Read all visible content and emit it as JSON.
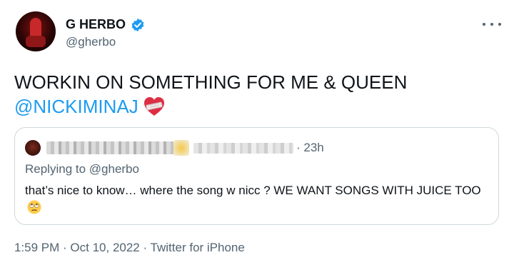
{
  "author": {
    "display_name": "G HERBO",
    "handle": "@gherbo",
    "verified_icon": "verified-badge-icon",
    "avatar_icon": "avatar"
  },
  "tweet": {
    "text": "WORKIN ON SOMETHING FOR ME & QUEEN",
    "mention": "@NICKIMINAJ",
    "emoji": "mending-heart-icon"
  },
  "quoted_tweet": {
    "time": "· 23h",
    "replying_to": "Replying to @gherbo",
    "text": "that’s nice to know… where the song w nicc ? WE WANT SONGS WITH JUICE TOO",
    "emoji": "face-with-rolling-eyes-icon"
  },
  "footer": {
    "meta": "1:59 PM · Oct 10, 2022 · Twitter for iPhone"
  },
  "colors": {
    "accent": "#1d9bf0",
    "secondary_text": "#536471",
    "border": "#cfd9de"
  }
}
